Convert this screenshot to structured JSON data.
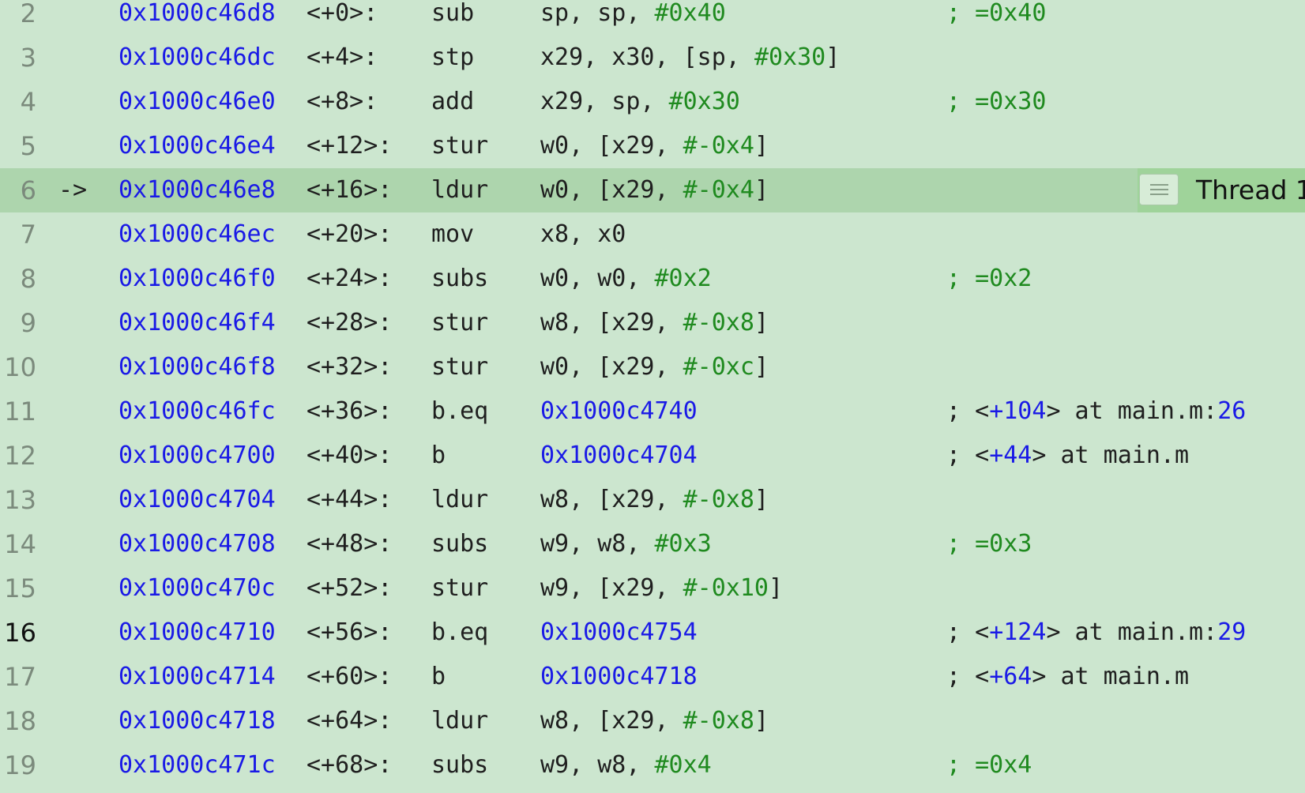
{
  "current_line": 6,
  "current_marker": "->",
  "thread_badge": "Thread 1",
  "lines": [
    {
      "num": "2",
      "addr": "0x1000c46d8",
      "off": "<+0>:",
      "mn": "sub",
      "ops": [
        [
          "sp, sp, ",
          "d"
        ],
        [
          "#0x40",
          "g"
        ]
      ],
      "cm": [
        [
          "; =0x40",
          "g"
        ]
      ]
    },
    {
      "num": "3",
      "addr": "0x1000c46dc",
      "off": "<+4>:",
      "mn": "stp",
      "ops": [
        [
          "x29, x30, [sp, ",
          "d"
        ],
        [
          "#0x30",
          "g"
        ],
        [
          "]",
          "d"
        ]
      ],
      "cm": []
    },
    {
      "num": "4",
      "addr": "0x1000c46e0",
      "off": "<+8>:",
      "mn": "add",
      "ops": [
        [
          "x29, sp, ",
          "d"
        ],
        [
          "#0x30",
          "g"
        ]
      ],
      "cm": [
        [
          "; =0x30",
          "g"
        ]
      ]
    },
    {
      "num": "5",
      "addr": "0x1000c46e4",
      "off": "<+12>:",
      "mn": "stur",
      "ops": [
        [
          "w0, [x29, ",
          "d"
        ],
        [
          "#-0x4",
          "g"
        ],
        [
          "]",
          "d"
        ]
      ],
      "cm": []
    },
    {
      "num": "6",
      "addr": "0x1000c46e8",
      "off": "<+16>:",
      "mn": "ldur",
      "ops": [
        [
          "w0, [x29, ",
          "d"
        ],
        [
          "#-0x4",
          "g"
        ],
        [
          "]",
          "d"
        ]
      ],
      "cm": []
    },
    {
      "num": "7",
      "addr": "0x1000c46ec",
      "off": "<+20>:",
      "mn": "mov",
      "ops": [
        [
          "x8, x0",
          "d"
        ]
      ],
      "cm": []
    },
    {
      "num": "8",
      "addr": "0x1000c46f0",
      "off": "<+24>:",
      "mn": "subs",
      "ops": [
        [
          "w0, w0, ",
          "d"
        ],
        [
          "#0x2",
          "g"
        ]
      ],
      "cm": [
        [
          "; =0x2",
          "g"
        ]
      ]
    },
    {
      "num": "9",
      "addr": "0x1000c46f4",
      "off": "<+28>:",
      "mn": "stur",
      "ops": [
        [
          "w8, [x29, ",
          "d"
        ],
        [
          "#-0x8",
          "g"
        ],
        [
          "]",
          "d"
        ]
      ],
      "cm": []
    },
    {
      "num": "10",
      "addr": "0x1000c46f8",
      "off": "<+32>:",
      "mn": "stur",
      "ops": [
        [
          "w0, [x29, ",
          "d"
        ],
        [
          "#-0xc",
          "g"
        ],
        [
          "]",
          "d"
        ]
      ],
      "cm": []
    },
    {
      "num": "11",
      "addr": "0x1000c46fc",
      "off": "<+36>:",
      "mn": "b.eq",
      "ops": [
        [
          "0x1000c4740",
          "b"
        ]
      ],
      "cm": [
        [
          "; <",
          "d"
        ],
        [
          "+104",
          "b"
        ],
        [
          "> at main.m:",
          "d"
        ],
        [
          "26",
          "b"
        ]
      ]
    },
    {
      "num": "12",
      "addr": "0x1000c4700",
      "off": "<+40>:",
      "mn": "b",
      "ops": [
        [
          "0x1000c4704",
          "b"
        ]
      ],
      "cm": [
        [
          "; <",
          "d"
        ],
        [
          "+44",
          "b"
        ],
        [
          "> at main.m",
          "d"
        ]
      ]
    },
    {
      "num": "13",
      "addr": "0x1000c4704",
      "off": "<+44>:",
      "mn": "ldur",
      "ops": [
        [
          "w8, [x29, ",
          "d"
        ],
        [
          "#-0x8",
          "g"
        ],
        [
          "]",
          "d"
        ]
      ],
      "cm": []
    },
    {
      "num": "14",
      "addr": "0x1000c4708",
      "off": "<+48>:",
      "mn": "subs",
      "ops": [
        [
          "w9, w8, ",
          "d"
        ],
        [
          "#0x3",
          "g"
        ]
      ],
      "cm": [
        [
          "; =0x3",
          "g"
        ]
      ]
    },
    {
      "num": "15",
      "addr": "0x1000c470c",
      "off": "<+52>:",
      "mn": "stur",
      "ops": [
        [
          "w9, [x29, ",
          "d"
        ],
        [
          "#-0x10",
          "g"
        ],
        [
          "]",
          "d"
        ]
      ],
      "cm": []
    },
    {
      "num": "16",
      "addr": "0x1000c4710",
      "off": "<+56>:",
      "mn": "b.eq",
      "ops": [
        [
          "0x1000c4754",
          "b"
        ]
      ],
      "cm": [
        [
          "; <",
          "d"
        ],
        [
          "+124",
          "b"
        ],
        [
          "> at main.m:",
          "d"
        ],
        [
          "29",
          "b"
        ]
      ]
    },
    {
      "num": "17",
      "addr": "0x1000c4714",
      "off": "<+60>:",
      "mn": "b",
      "ops": [
        [
          "0x1000c4718",
          "b"
        ]
      ],
      "cm": [
        [
          "; <",
          "d"
        ],
        [
          "+64",
          "b"
        ],
        [
          "> at main.m",
          "d"
        ]
      ]
    },
    {
      "num": "18",
      "addr": "0x1000c4718",
      "off": "<+64>:",
      "mn": "ldur",
      "ops": [
        [
          "w8, [x29, ",
          "d"
        ],
        [
          "#-0x8",
          "g"
        ],
        [
          "]",
          "d"
        ]
      ],
      "cm": []
    },
    {
      "num": "19",
      "addr": "0x1000c471c",
      "off": "<+68>:",
      "mn": "subs",
      "ops": [
        [
          "w9, w8, ",
          "d"
        ],
        [
          "#0x4",
          "g"
        ]
      ],
      "cm": [
        [
          "; =0x4",
          "g"
        ]
      ]
    }
  ]
}
